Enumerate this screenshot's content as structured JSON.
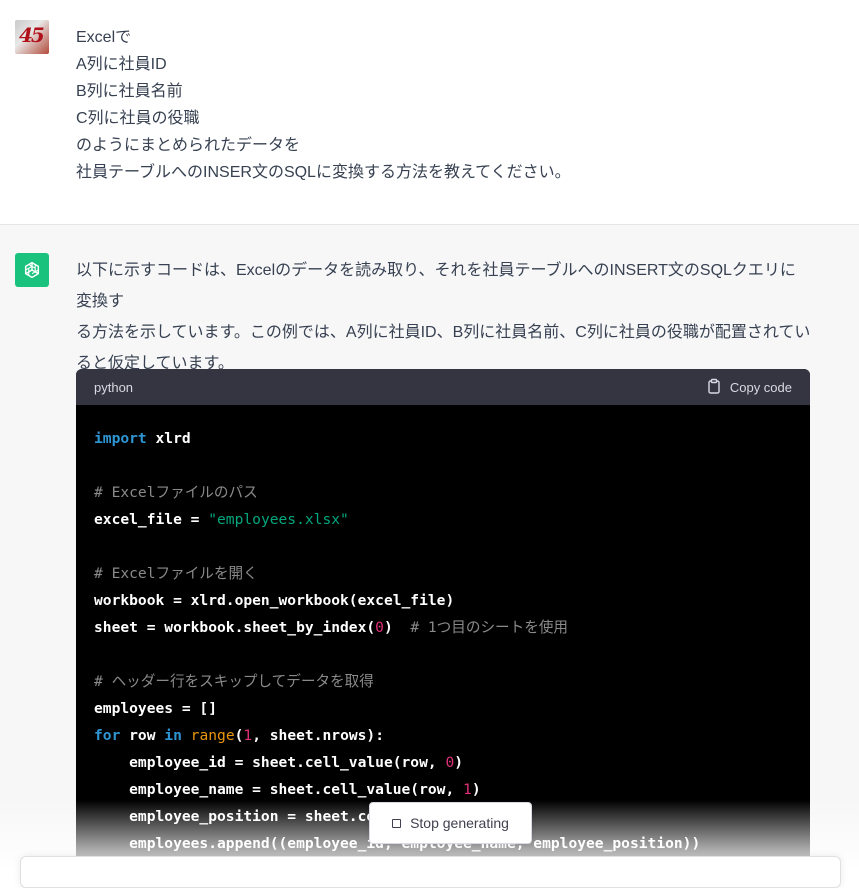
{
  "user_message": {
    "lines": [
      "Excelで",
      "A列に社員ID",
      "B列に社員名前",
      "C列に社員の役職",
      "のようにまとめられたデータを",
      "社員テーブルへのINSER文のSQLに変換する方法を教えてください。"
    ]
  },
  "assistant_message": {
    "paragraph_lines": [
      "以下に示すコードは、Excelのデータを読み取り、それを社員テーブルへのINSERT文のSQLクエリに変換す",
      "る方法を示しています。この例では、A列に社員ID、B列に社員名前、C列に社員の役職が配置されてい",
      "ると仮定しています。"
    ],
    "code_block": {
      "language": "python",
      "copy_label": "Copy code",
      "lines": [
        [
          {
            "t": "kw",
            "v": "import"
          },
          {
            "t": "p",
            "v": " xlrd"
          }
        ],
        [],
        [
          {
            "t": "cm",
            "v": "# Excelファイルのパス"
          }
        ],
        [
          {
            "t": "p",
            "v": "excel_file = "
          },
          {
            "t": "str",
            "v": "\"employees.xlsx\""
          }
        ],
        [],
        [
          {
            "t": "cm",
            "v": "# Excelファイルを開く"
          }
        ],
        [
          {
            "t": "p",
            "v": "workbook = xlrd.open_workbook(excel_file)"
          }
        ],
        [
          {
            "t": "p",
            "v": "sheet = workbook.sheet_by_index("
          },
          {
            "t": "num",
            "v": "0"
          },
          {
            "t": "p",
            "v": ")  "
          },
          {
            "t": "cm",
            "v": "# 1つ目のシートを使用"
          }
        ],
        [],
        [
          {
            "t": "cm",
            "v": "# ヘッダー行をスキップしてデータを取得"
          }
        ],
        [
          {
            "t": "p",
            "v": "employees = []"
          }
        ],
        [
          {
            "t": "kw",
            "v": "for"
          },
          {
            "t": "p",
            "v": " row "
          },
          {
            "t": "kw",
            "v": "in"
          },
          {
            "t": "p",
            "v": " "
          },
          {
            "t": "bi",
            "v": "range"
          },
          {
            "t": "p",
            "v": "("
          },
          {
            "t": "num",
            "v": "1"
          },
          {
            "t": "p",
            "v": ", sheet.nrows):"
          }
        ],
        [
          {
            "t": "p",
            "v": "    employee_id = sheet.cell_value(row, "
          },
          {
            "t": "num",
            "v": "0"
          },
          {
            "t": "p",
            "v": ")"
          }
        ],
        [
          {
            "t": "p",
            "v": "    employee_name = sheet.cell_value(row, "
          },
          {
            "t": "num",
            "v": "1"
          },
          {
            "t": "p",
            "v": ")"
          }
        ],
        [
          {
            "t": "p",
            "v": "    employee_position = sheet.cell_value(row, "
          },
          {
            "t": "num",
            "v": "2"
          },
          {
            "t": "p",
            "v": ")"
          }
        ],
        [
          {
            "t": "p",
            "v": "    employees.append((employee_id, employee_name, employee_position))"
          }
        ]
      ]
    }
  },
  "controls": {
    "stop_label": "Stop generating"
  },
  "colors": {
    "gpt_brand": "#19c37d",
    "keyword": "#2e95d3",
    "string": "#00a67d",
    "number": "#df3079",
    "comment": "#8a8a8a",
    "builtin": "#e9950c"
  }
}
